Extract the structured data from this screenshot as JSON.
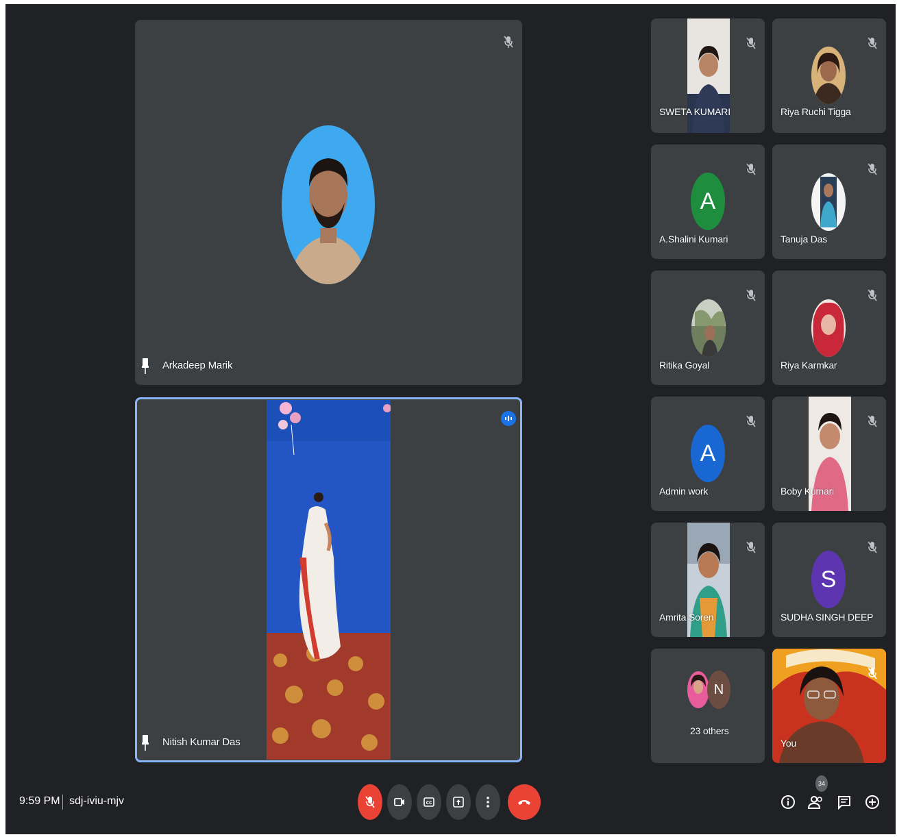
{
  "meeting": {
    "time": "9:59 PM",
    "code": "sdj-iviu-mjv",
    "participant_count": "34"
  },
  "main_tiles": [
    {
      "name": "Arkadeep Marik"
    },
    {
      "name": "Nitish Kumar Das"
    }
  ],
  "grid_tiles": [
    {
      "name": "SWETA KUMARI"
    },
    {
      "name": "Riya Ruchi Tigga"
    },
    {
      "name": "A.Shalini Kumari",
      "avatar_letter": "A"
    },
    {
      "name": "Tanuja Das"
    },
    {
      "name": "Ritika Goyal"
    },
    {
      "name": "Riya Karmkar"
    },
    {
      "name": "Admin work",
      "avatar_letter": "A"
    },
    {
      "name": "Boby Kumari"
    },
    {
      "name": "Amrita Soren"
    },
    {
      "name": "SUDHA SINGH DEEP",
      "avatar_letter": "S"
    },
    {
      "name": "23 others",
      "avatar_letter": "N"
    },
    {
      "name": "You"
    }
  ],
  "colors": {
    "background": "#202124",
    "tile": "#3c4043",
    "active_border": "#8ab4f8",
    "end_call": "#ea4335",
    "avatar_green": "#1e8e3e",
    "avatar_blue": "#1967d2",
    "avatar_purple": "#5e35b1"
  }
}
